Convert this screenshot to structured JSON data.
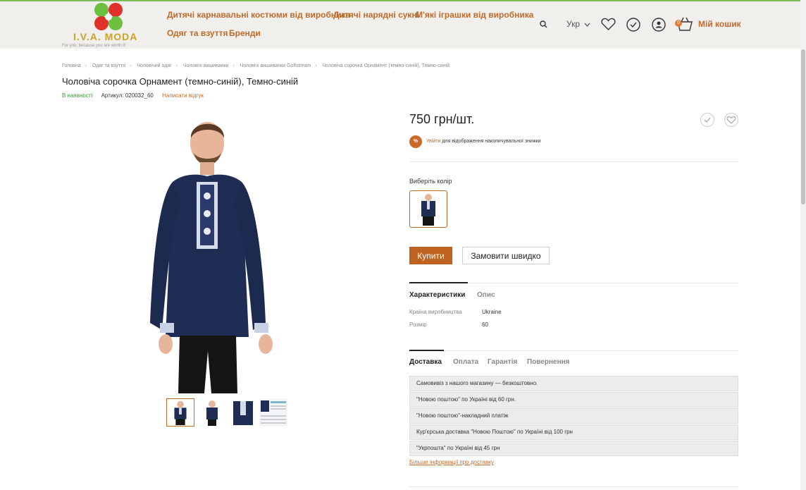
{
  "header": {
    "logo": {
      "brand": "I.V.A. MODA",
      "slogan": "For you, because you are worth it!"
    },
    "nav": [
      "Дитячі карнавальні костюми від виробника",
      "Дитячі нарядні сукні",
      "М'які іграшки від виробника",
      "Одяг та взуття",
      "Бренди"
    ],
    "lang": "Укр",
    "cart_count": "0",
    "cart_label": "Мій кошик"
  },
  "breadcrumb": [
    "Головна",
    "Одяг та взуття",
    "Чоловічий одяг",
    "Чоловічі вишиванки",
    "Чоловічі вишиванки Golfstream",
    "Чоловіча сорочка Орнамент (темно-синій), Темно-синій"
  ],
  "product": {
    "title": "Чоловіча сорочка Орнамент (темно-синій), Темно-синій",
    "stock": "В наявності",
    "sku": "Артикул: 020032_60",
    "review_link": "Написати відгук",
    "price": "750 грн/шт.",
    "discount": {
      "badge": "%",
      "link": "Увійти",
      "text": " для відображення накопичувальної знижки"
    },
    "color_label": "Виберіть колір",
    "buy_label": "Купити",
    "quick_label": "Замовити швидко"
  },
  "tabs_info": [
    "Характеристики",
    "Опис"
  ],
  "specs": [
    {
      "key": "Країна виробництва",
      "value": "Ukraine"
    },
    {
      "key": "Розмір",
      "value": "60"
    }
  ],
  "tabs_delivery": [
    "Доставка",
    "Оплата",
    "Гарантія",
    "Повернення"
  ],
  "delivery": [
    "Самовивіз з нашого магазину — безкоштовно.",
    "\"Новою поштою\" по Україні від 60 грн.",
    "\"Новою поштою\"-накладний платіж",
    "Кур'єрська доставка \"Новою Поштою\" по Україні від 100 грн",
    "\"Укрпошта\" по Україні від 45 грн"
  ],
  "delivery_more": "Більше інформації про доставку",
  "colors": {
    "accent": "#c06a2a",
    "stock": "#3a9a3a",
    "shirt": "#1f2d55"
  }
}
